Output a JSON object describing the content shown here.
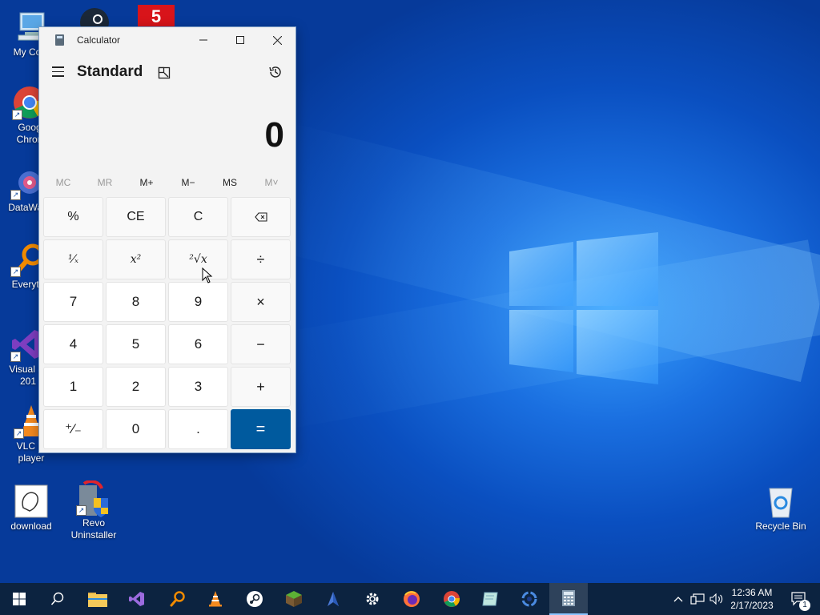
{
  "desktop": {
    "icons": [
      {
        "label": "My Com"
      },
      {
        "label": "Goog\nChron"
      },
      {
        "label": "DataWag"
      },
      {
        "label": "Everyth"
      },
      {
        "label": "Visual St\n201"
      },
      {
        "label": "VLC m\nplayer"
      },
      {
        "label": "download"
      },
      {
        "label": "Revo\nUninstaller"
      },
      {
        "label": "Recycle Bin"
      }
    ]
  },
  "calculator": {
    "window_title": "Calculator",
    "mode": "Standard",
    "display_value": "0",
    "memory": [
      "MC",
      "MR",
      "M+",
      "M−",
      "MS",
      "M˅"
    ],
    "keys": [
      "%",
      "CE",
      "C",
      "⌫",
      "¹⁄ₓ",
      "x²",
      "²√x",
      "÷",
      "7",
      "8",
      "9",
      "×",
      "4",
      "5",
      "6",
      "−",
      "1",
      "2",
      "3",
      "+",
      "⁺⁄₋",
      "0",
      ".",
      "="
    ]
  },
  "taskbar": {
    "clock_time": "12:36 AM",
    "clock_date": "2/17/2023",
    "notification_count": "1"
  },
  "colors": {
    "accent": "#005a9e",
    "taskbar": "#0c2340"
  }
}
